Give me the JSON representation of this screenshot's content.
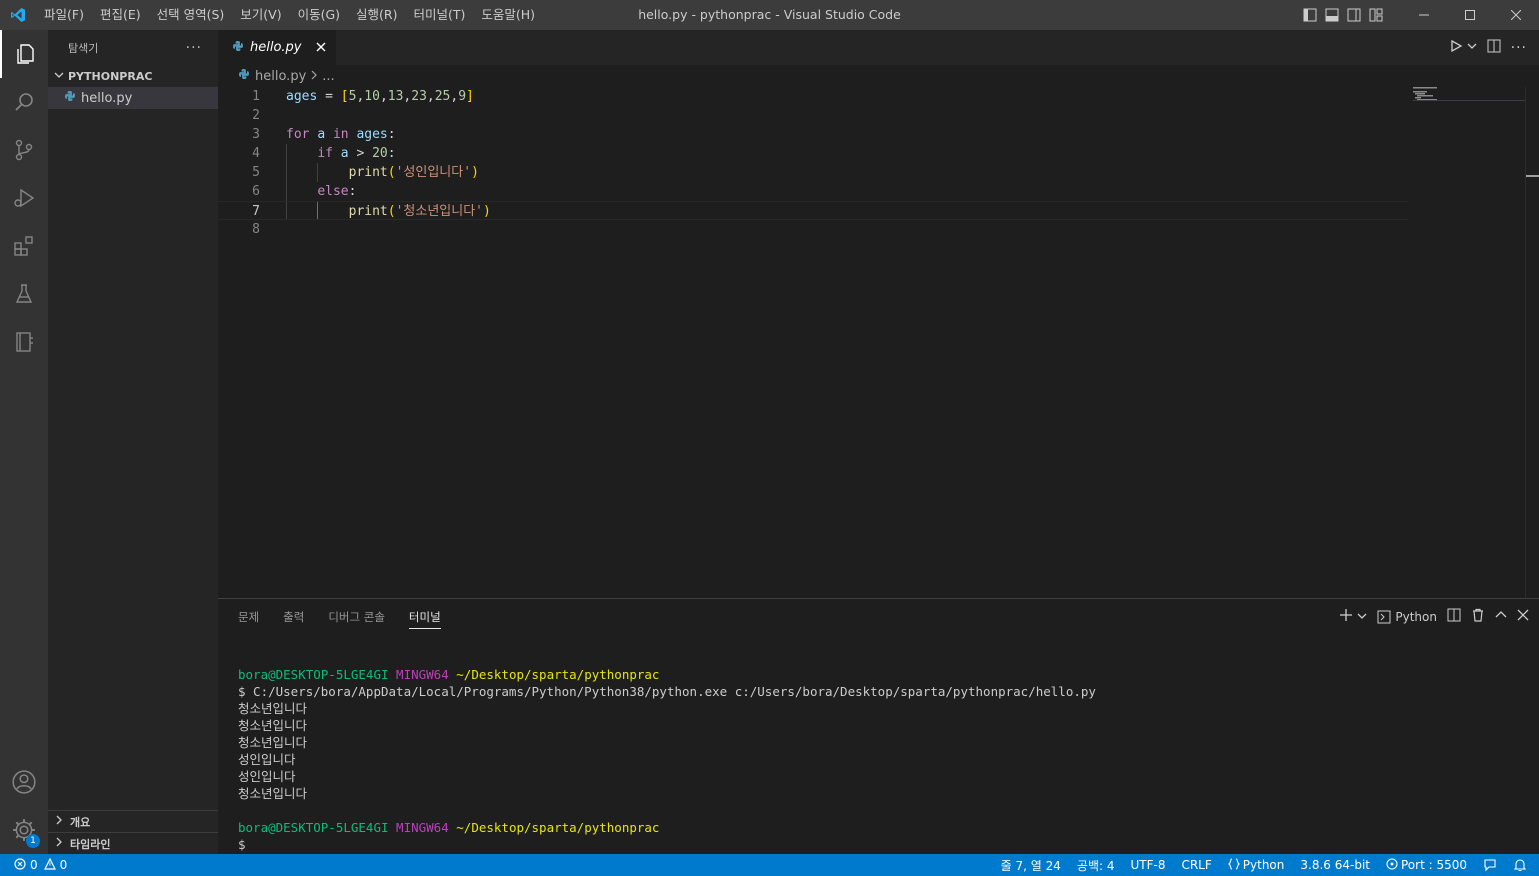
{
  "titlebar": {
    "title": "hello.py - pythonprac - Visual Studio Code",
    "menu": [
      "파일(F)",
      "편집(E)",
      "선택 영역(S)",
      "보기(V)",
      "이동(G)",
      "실행(R)",
      "터미널(T)",
      "도움말(H)"
    ]
  },
  "colors": {
    "accent": "#007acc",
    "brand": "#23a9f2"
  },
  "activity_bar": [
    "explorer-icon",
    "search-icon",
    "source-control-icon",
    "run-debug-icon",
    "extensions-icon",
    "testing-icon",
    "notebook-icon",
    "account-icon",
    "settings-gear-icon"
  ],
  "settings_badge": "1",
  "sidebar": {
    "title": "탐색기",
    "folder": "PYTHONPRAC",
    "files": [
      "hello.py"
    ],
    "sections": [
      "개요",
      "타임라인"
    ]
  },
  "editor": {
    "tab_label": "hello.py",
    "breadcrumb_file": "hello.py",
    "breadcrumb_more": "...",
    "line_numbers": [
      "1",
      "2",
      "3",
      "4",
      "5",
      "6",
      "7",
      "8"
    ],
    "lines": [
      "ages = [5,10,13,23,25,9]",
      "",
      "for a in ages:",
      "    if a > 20:",
      "        print('성인입니다')",
      "    else:",
      "        print('청소년입니다')",
      ""
    ],
    "current_line": 7
  },
  "panel": {
    "tabs": [
      "문제",
      "출력",
      "디버그 콘솔",
      "터미널"
    ],
    "active_tab": "터미널",
    "terminal_profile": "Python",
    "terminal": {
      "prompt_user": "bora@DESKTOP-5LGE4GI",
      "prompt_env": "MINGW64",
      "prompt_path": "~/Desktop/sparta/pythonprac",
      "command": "$ C:/Users/bora/AppData/Local/Programs/Python/Python38/python.exe c:/Users/bora/Desktop/sparta/pythonprac/hello.py",
      "output": [
        "청소년입니다",
        "청소년입니다",
        "청소년입니다",
        "성인입니다",
        "성인입니다",
        "청소년입니다"
      ],
      "cursor_prompt": "$"
    }
  },
  "statusbar": {
    "errors": "0",
    "warnings": "0",
    "position": "줄 7, 열 24",
    "indent": "공백: 4",
    "encoding": "UTF-8",
    "eol": "CRLF",
    "language": "Python",
    "interpreter": "3.8.6 64-bit",
    "port": "Port : 5500"
  }
}
